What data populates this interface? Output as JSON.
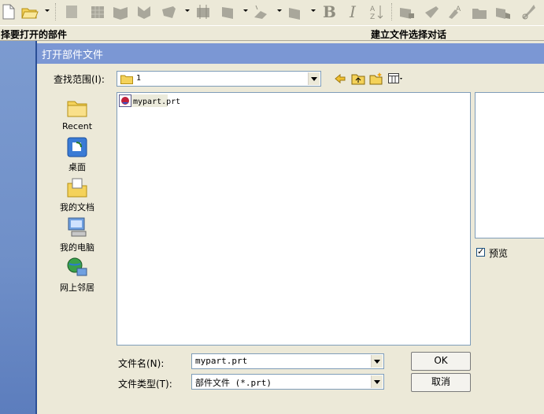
{
  "toolbar": {
    "bold_label": "B",
    "italic_label": "I",
    "icons": [
      "new-file-icon",
      "open-folder-icon",
      "part-icon",
      "grid-icon",
      "book-icon",
      "draw-icon",
      "pen-icon",
      "layer-icon",
      "box-icon",
      "shape-icon",
      "layer2-icon",
      "sort-icon",
      "bar-icon",
      "edit-icon",
      "style-icon",
      "folder-icon",
      "save-icon",
      "wrench-icon"
    ]
  },
  "status": {
    "left_text": "择要打开的部件",
    "right_text": "建立文件选择对话"
  },
  "dialog": {
    "title": "打开部件文件",
    "look_in_label": "查找范围(I):",
    "look_in_value": "1",
    "places": [
      {
        "label": "Recent",
        "icon": "recent-folder-icon"
      },
      {
        "label": "桌面",
        "icon": "desktop-icon"
      },
      {
        "label": "我的文档",
        "icon": "my-documents-icon"
      },
      {
        "label": "我的电脑",
        "icon": "my-computer-icon"
      },
      {
        "label": "网上邻居",
        "icon": "network-icon"
      }
    ],
    "files": [
      {
        "name": "mypart.prt",
        "icon": "prt-file-icon"
      }
    ],
    "preview_label": "预览",
    "preview_checked": true,
    "filename_label": "文件名(N):",
    "filename_value": "mypart.prt",
    "filetype_label": "文件类型(T):",
    "filetype_value": "部件文件 (*.prt)",
    "ok_label": "OK",
    "cancel_label": "取消"
  }
}
